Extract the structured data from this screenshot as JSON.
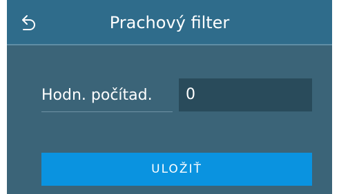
{
  "header": {
    "title": "Prachový filter",
    "back_icon": "back-arrow-icon"
  },
  "form": {
    "counter_label": "Hodn. počítad.",
    "counter_value": "0"
  },
  "actions": {
    "save_label": "ULOŽIŤ"
  },
  "colors": {
    "background": "#3b6478",
    "header": "#2f6c8b",
    "input": "#294b5b",
    "accent": "#0a93e0"
  }
}
